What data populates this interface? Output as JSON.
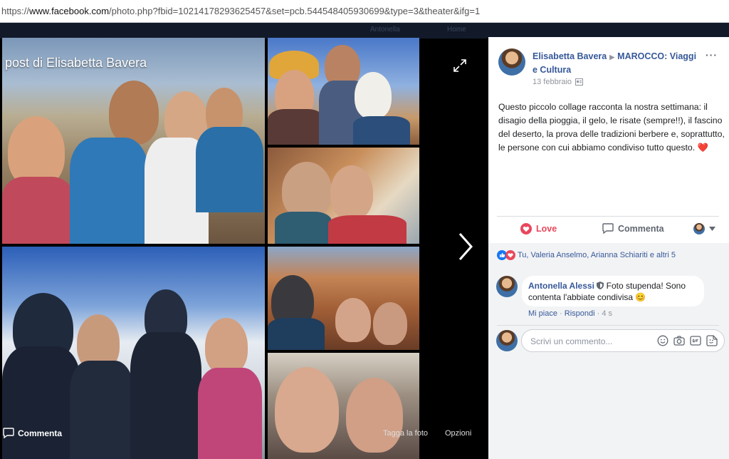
{
  "browser": {
    "url_prefix": "https://",
    "url_domain": "www.facebook.com",
    "url_path": "/photo.php?fbid=10214178293625457&set=pcb.544548405930699&type=3&theater&ifg=1"
  },
  "background_page": {
    "user_name": "Antonella",
    "nav_home": "Home"
  },
  "photo": {
    "title": "post di Elisabetta Bavera",
    "comment_label": "Commenta",
    "tag_label": "Tagga la foto",
    "options_label": "Opzioni"
  },
  "post": {
    "author": "Elisabetta Bavera",
    "group": "MAROCCO: Viaggi e Cultura",
    "date": "13 febbraio",
    "more_label": "···",
    "text": "Questo piccolo collage racconta la nostra settimana: il disagio della pioggia, il gelo, le risate (sempre!!), il fascino del deserto, la prova delle tradizioni berbere e, soprattutto, le persone con cui abbiamo condiviso tutto questo.",
    "text_emoji": "❤️",
    "actions": {
      "love": "Love",
      "comment": "Commenta"
    },
    "reactions_text": "Tu, Valeria Anselmo, Arianna Schiariti e altri 5"
  },
  "comment": {
    "author": "Antonella Alessi",
    "text": "Foto stupenda! Sono contenta l'abbiate condivisa",
    "emoji": "😊",
    "like": "Mi piace",
    "reply": "Rispondi",
    "time": "4 s",
    "separator": "·"
  },
  "composer": {
    "placeholder": "Scrivi un commento..."
  },
  "colors": {
    "link": "#365899",
    "love": "#e9475b",
    "meta": "#90949c"
  }
}
